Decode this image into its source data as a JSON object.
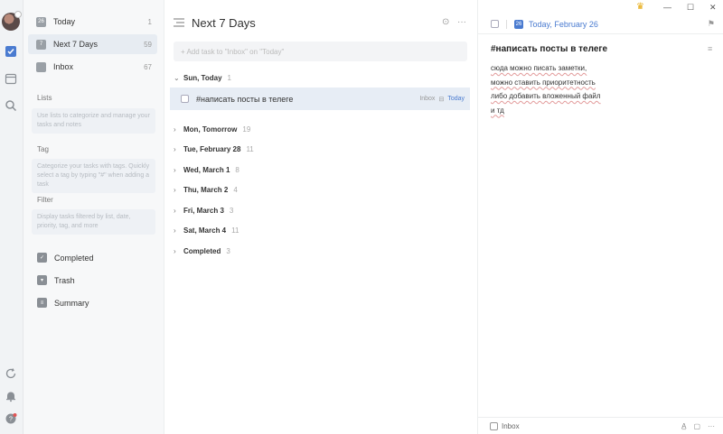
{
  "sidebar": {
    "smart_lists": [
      {
        "label": "Today",
        "count": "1",
        "icon": "calendar-today-icon",
        "glyph": "26"
      },
      {
        "label": "Next 7 Days",
        "count": "59",
        "icon": "calendar-week-icon",
        "glyph": "7"
      },
      {
        "label": "Inbox",
        "count": "67",
        "icon": "inbox-icon",
        "glyph": ""
      }
    ],
    "lists_title": "Lists",
    "lists_hint": "Use lists to categorize and manage your tasks and notes",
    "tag_title": "Tag",
    "tag_hint": "Categorize your tasks with tags. Quickly select a tag by typing \"#\" when adding a task",
    "filter_title": "Filter",
    "filter_hint": "Display tasks filtered by list, date, priority, tag, and more",
    "footer": [
      {
        "label": "Completed",
        "icon": "checkbox-checked-icon"
      },
      {
        "label": "Trash",
        "icon": "trash-icon"
      },
      {
        "label": "Summary",
        "icon": "summary-icon"
      }
    ]
  },
  "main": {
    "title": "Next 7 Days",
    "add_placeholder": "+ Add task to \"Inbox\" on \"Today\"",
    "groups": [
      {
        "label": "Sun, Today",
        "count": "1",
        "expanded": true
      },
      {
        "label": "Mon, Tomorrow",
        "count": "19"
      },
      {
        "label": "Tue, February 28",
        "count": "11"
      },
      {
        "label": "Wed, March 1",
        "count": "8"
      },
      {
        "label": "Thu, March 2",
        "count": "4"
      },
      {
        "label": "Fri, March 3",
        "count": "3"
      },
      {
        "label": "Sat, March 4",
        "count": "11"
      },
      {
        "label": "Completed",
        "count": "3"
      }
    ],
    "task": {
      "title": "#написать посты в телеге",
      "list": "Inbox",
      "due": "Today"
    }
  },
  "detail": {
    "date": "Today, February 26",
    "calendar_glyph": "26",
    "title": "#написать посты в телеге",
    "notes": [
      "сюда можно писать заметки,",
      "можно ставить приоритетность",
      "либо добавить вложенный файл",
      "и тд"
    ],
    "footer_list": "Inbox"
  },
  "colors": {
    "accent": "#4a7bd0",
    "selected_row": "#e7edf5",
    "crown": "#e6a90e"
  }
}
